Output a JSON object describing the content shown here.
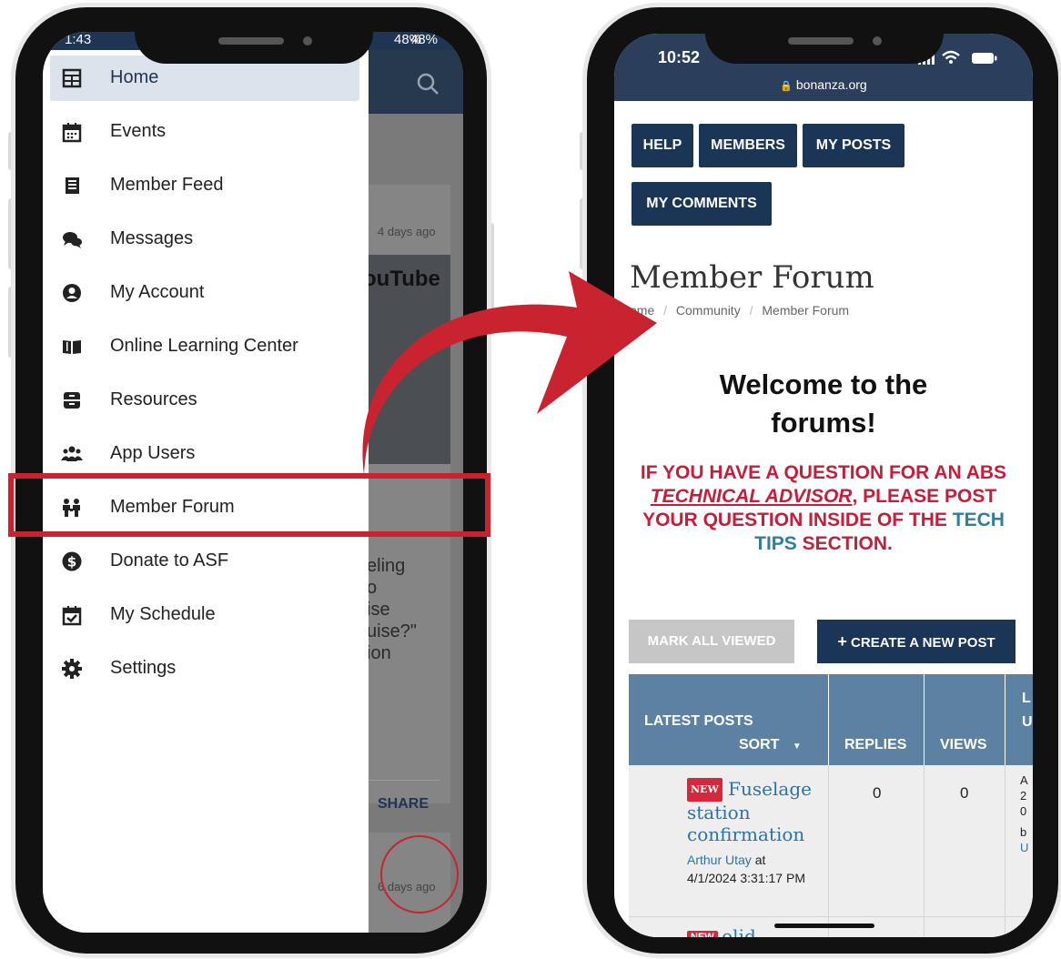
{
  "left_phone": {
    "status": {
      "time": "1:43",
      "battery": "48%"
    },
    "drawer_items": [
      {
        "label": "Home",
        "icon": "home-grid-icon"
      },
      {
        "label": "Events",
        "icon": "calendar-icon"
      },
      {
        "label": "Member Feed",
        "icon": "newspaper-icon"
      },
      {
        "label": "Messages",
        "icon": "chat-bubbles-icon"
      },
      {
        "label": "My Account",
        "icon": "user-circle-icon"
      },
      {
        "label": "Online Learning Center",
        "icon": "open-book-icon"
      },
      {
        "label": "Resources",
        "icon": "archive-box-icon"
      },
      {
        "label": "App Users",
        "icon": "users-group-icon"
      },
      {
        "label": "Member Forum",
        "icon": "forum-people-icon"
      },
      {
        "label": "Donate to ASF",
        "icon": "dollar-circle-icon"
      },
      {
        "label": "My Schedule",
        "icon": "calendar-check-icon"
      },
      {
        "label": "Settings",
        "icon": "gear-icon"
      }
    ],
    "background": {
      "card1_time": "4 days ago",
      "youtube_text": "ouTube",
      "snippet": [
        "eling",
        "o",
        "ise",
        "uise?\"",
        "ion"
      ],
      "share": "SHARE",
      "card2_time": "6 days ago"
    }
  },
  "right_phone": {
    "status_time": "10:52",
    "url": "bonanza.org",
    "nav_buttons": [
      "HELP",
      "MEMBERS",
      "MY POSTS",
      "MY COMMENTS"
    ],
    "page_title": "Member Forum",
    "breadcrumb": [
      "ome",
      "Community",
      "Member Forum"
    ],
    "welcome_line1": "Welcome to the",
    "welcome_line2": "forums!",
    "notice": {
      "part1": "IF YOU HAVE A QUESTION FOR AN ABS ",
      "advisor": "TECHNICAL ADVISOR",
      "part2": ", PLEASE POST YOUR QUESTION INSIDE OF THE ",
      "tech_tips": "TECH TIPS",
      "part3": " SECTION."
    },
    "mark_all_viewed": "MARK ALL VIEWED",
    "create_post": "CREATE A NEW POST",
    "table": {
      "col_latest": "LATEST POSTS",
      "col_sort": "SORT",
      "col_replies": "REPLIES",
      "col_views": "VIEWS",
      "col_last_fragment": [
        "L",
        "U"
      ],
      "row": {
        "badge": "NEW",
        "title": "Fuselage station confirmation",
        "author": "Arthur Utay",
        "at": "at",
        "date": "4/1/2024 3:31:17 PM",
        "replies": "0",
        "views": "0",
        "last_fragment": [
          "A",
          "2",
          "0",
          "b",
          "U"
        ]
      },
      "next_row_fragment": "olid"
    }
  },
  "colors": {
    "highlight": "#c8232f",
    "navy": "#1a3555",
    "table_header": "#5d81a2"
  }
}
